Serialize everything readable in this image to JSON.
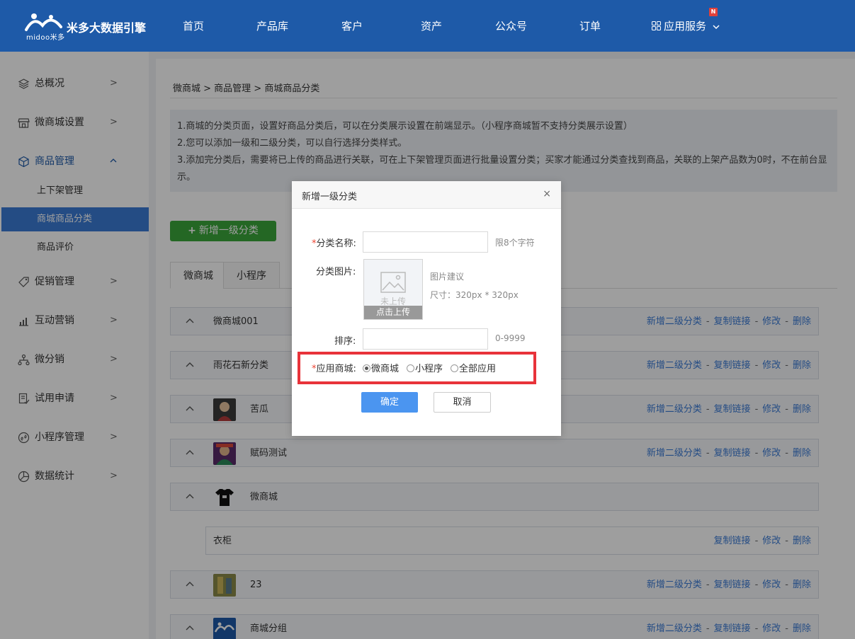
{
  "header": {
    "logo_sub": "midoo米多",
    "logo_title": "米多大数据引擎",
    "nav": [
      "首页",
      "产品库",
      "客户",
      "资产",
      "公众号",
      "订单"
    ],
    "app_service": "应用服务",
    "badge": "N"
  },
  "sidebar": {
    "items": [
      {
        "label": "总概况"
      },
      {
        "label": "微商城设置"
      },
      {
        "label": "商品管理"
      },
      {
        "label": "促销管理"
      },
      {
        "label": "互动营销"
      },
      {
        "label": "微分销"
      },
      {
        "label": "试用申请"
      },
      {
        "label": "小程序管理"
      },
      {
        "label": "数据统计"
      }
    ],
    "sub_items": [
      "上下架管理",
      "商城商品分类",
      "商品评价"
    ]
  },
  "main": {
    "breadcrumb": "微商城 > 商品管理 > 商城商品分类",
    "notice": [
      "1.商城的分类页面，设置好商品分类后，可以在分类展示设置在前端显示。（小程序商城暂不支持分类展示设置）",
      "2.您可以添加一级和二级分类，可以自行选择分类样式。",
      "3.添加完分类后，需要将已上传的商品进行关联，可在上下架管理页面进行批量设置分类；买家才能通过分类查找到商品，关联的上架产品数为0时，不在前台显示。"
    ],
    "add_button": "新增一级分类",
    "tabs": [
      "微商城",
      "小程序"
    ],
    "actions": {
      "add_sub": "新增二级分类",
      "copy": "复制链接",
      "edit": "修改",
      "delete": "删除",
      "sep": "-"
    },
    "rows": [
      {
        "name": "微商城001"
      },
      {
        "name": "雨花石新分类"
      },
      {
        "name": "苦瓜"
      },
      {
        "name": "赋码测试"
      },
      {
        "name": "微商城"
      },
      {
        "name": "衣柜"
      },
      {
        "name": "23"
      },
      {
        "name": "商城分组"
      }
    ]
  },
  "modal": {
    "title": "新增一级分类",
    "close": "×",
    "name_label": "分类名称:",
    "name_value": "",
    "name_hint": "限8个字符",
    "image_label": "分类图片:",
    "upload_placeholder": "未上传",
    "upload_button": "点击上传",
    "image_hint_1": "图片建议",
    "image_hint_2": "尺寸：320px * 320px",
    "sort_label": "排序:",
    "sort_value": "",
    "sort_hint": "0-9999",
    "apply_label": "应用商城:",
    "apply_options": [
      "微商城",
      "小程序",
      "全部应用"
    ],
    "apply_selected": "微商城",
    "confirm": "确定",
    "cancel": "取消",
    "required_mark": "*"
  },
  "colors": {
    "header_bg": "#1e5aa8",
    "add_button": "#3ba63b",
    "confirm_button": "#4b95f0",
    "link": "#3b7bd6",
    "highlight": "#e8333a"
  }
}
